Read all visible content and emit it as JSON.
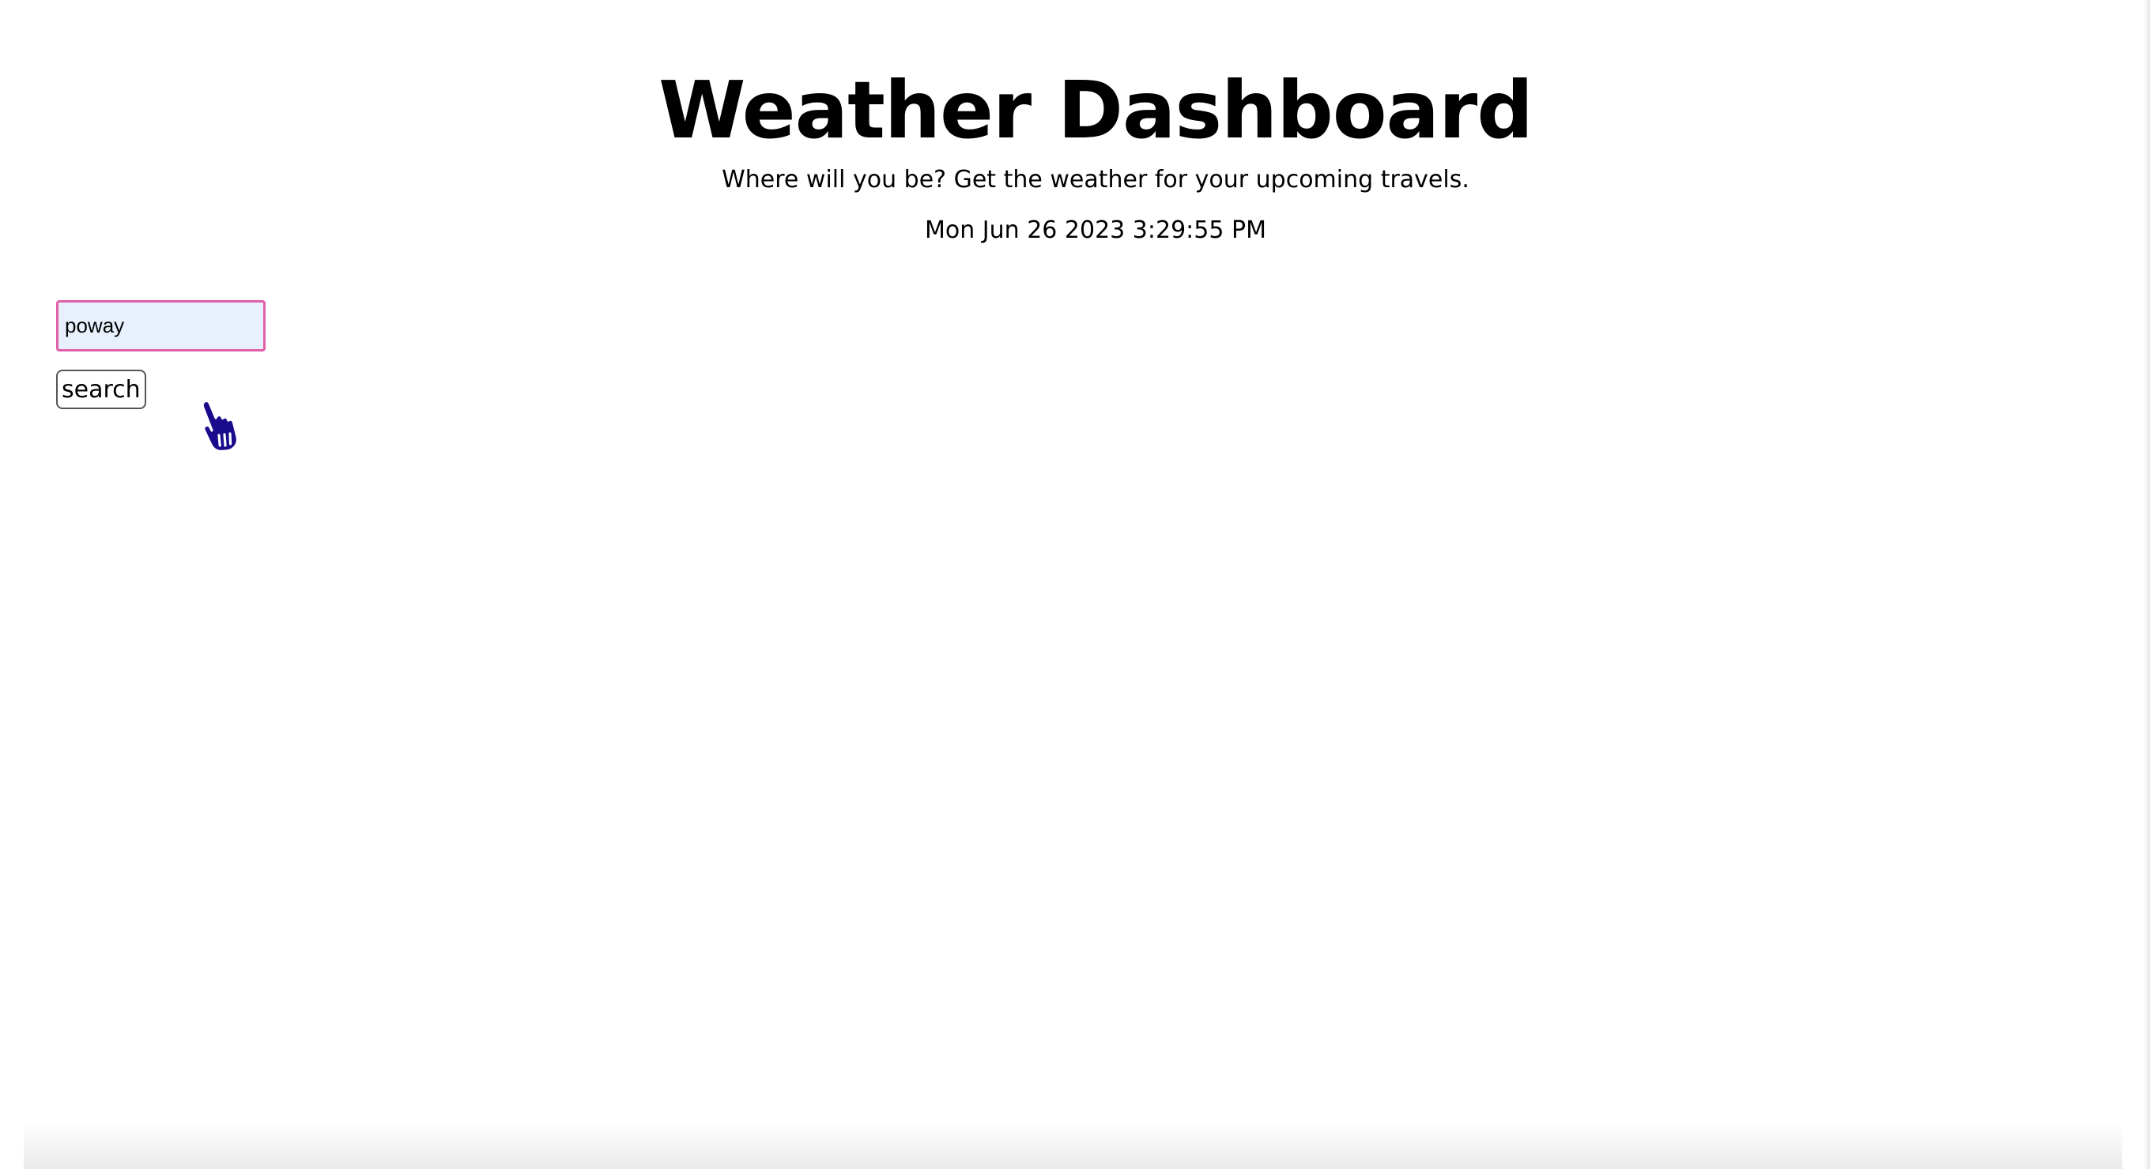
{
  "header": {
    "title": "Weather Dashboard",
    "subtitle": "Where will you be? Get the weather for your upcoming travels.",
    "datetime": "Mon Jun 26 2023 3:29:55 PM"
  },
  "search": {
    "input_value": "poway",
    "button_label": "search"
  },
  "cursor": {
    "icon": "hand-pointer-icon"
  },
  "colors": {
    "input_background": "#e8f0fe",
    "input_border": "#e05fa8",
    "cursor_fill": "#1a0a8c"
  }
}
